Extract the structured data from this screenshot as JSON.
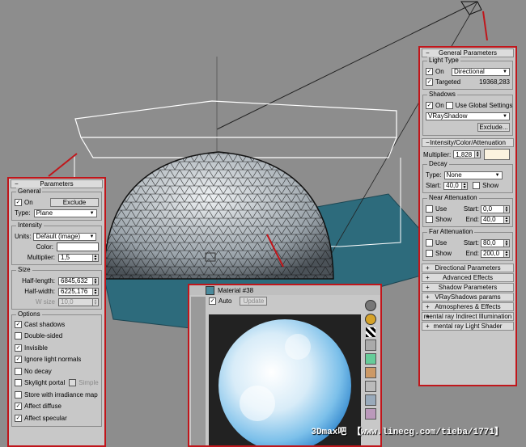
{
  "left_panel": {
    "title": "Parameters",
    "general": {
      "title": "General",
      "on_label": "On",
      "exclude_label": "Exclude",
      "type_label": "Type:",
      "type_value": "Plane"
    },
    "intensity": {
      "title": "Intensity",
      "units_label": "Units:",
      "units_value": "Default (image)",
      "color_label": "Color:",
      "multiplier_label": "Multiplier:",
      "multiplier_value": "1,5"
    },
    "size": {
      "title": "Size",
      "half_length_label": "Half-length:",
      "half_length_value": "6845,632",
      "half_width_label": "Half-width:",
      "half_width_value": "6225,176",
      "wsize_label": "W size",
      "wsize_value": "10,0"
    },
    "options": {
      "title": "Options",
      "items": [
        {
          "label": "Cast shadows",
          "checked": "✓"
        },
        {
          "label": "Double-sided",
          "checked": ""
        },
        {
          "label": "Invisible",
          "checked": "✓"
        },
        {
          "label": "Ignore light normals",
          "checked": "✓"
        },
        {
          "label": "No decay",
          "checked": ""
        },
        {
          "label": "Skylight portal",
          "checked": ""
        },
        {
          "label": "Store with irradiance map",
          "checked": ""
        },
        {
          "label": "Affect diffuse",
          "checked": "✓"
        },
        {
          "label": "Affect specular",
          "checked": "✓"
        }
      ],
      "simple_label": "Simple"
    }
  },
  "right_panel": {
    "general_title": "General Parameters",
    "light_type": {
      "title": "Light Type",
      "on_label": "On",
      "type_value": "Directional",
      "targeted_label": "Targeted",
      "targeted_value": "19368,283"
    },
    "shadows": {
      "title": "Shadows",
      "on_label": "On",
      "global_label": "Use Global Settings",
      "type_value": "VRayShadow",
      "exclude_label": "Exclude..."
    },
    "intensity_title": "Intensity/Color/Attenuation",
    "multiplier_label": "Multiplier:",
    "multiplier_value": "1,828",
    "decay": {
      "title": "Decay",
      "type_label": "Type:",
      "type_value": "None",
      "start_label": "Start:",
      "start_value": "40,0",
      "show_label": "Show"
    },
    "near": {
      "title": "Near Attenuation",
      "use_label": "Use",
      "show_label": "Show",
      "start_label": "Start:",
      "start_value": "0,0",
      "end_label": "End:",
      "end_value": "40,0"
    },
    "far": {
      "title": "Far Attenuation",
      "use_label": "Use",
      "show_label": "Show",
      "start_label": "Start:",
      "start_value": "80,0",
      "end_label": "End:",
      "end_value": "200,0"
    },
    "rollouts": [
      "Directional Parameters",
      "Advanced Effects",
      "Shadow Parameters",
      "VRayShadows params",
      "Atmospheres & Effects",
      "mental ray Indirect Illumination",
      "mental ray Light Shader"
    ]
  },
  "material_editor": {
    "title": "Material #38",
    "auto_label": "Auto",
    "update_label": "Update"
  },
  "watermark": "3Dmax吧 【www.linecg.com/tieba/1771】",
  "colors": {
    "highlight_border": "#c0161b",
    "panel_bg": "#c8c8c8",
    "viewport_bg": "#8d8d8d",
    "ground_plane": "#2d6b7c"
  }
}
